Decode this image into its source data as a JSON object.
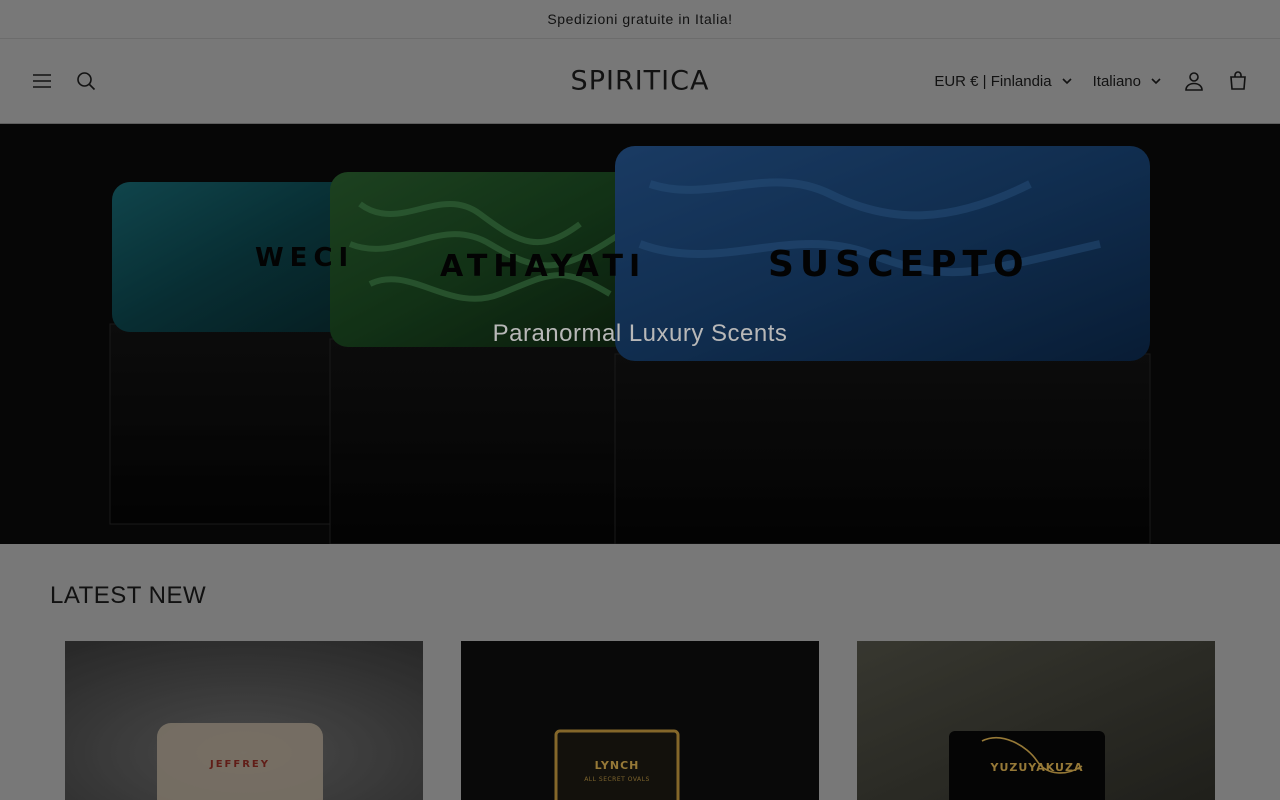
{
  "announcement": "Spedizioni gratuite in Italia!",
  "header": {
    "logo": "SPIRITICA",
    "currency": "EUR € | Finlandia",
    "language": "Italiano",
    "icons": [
      "menu-icon",
      "search-icon",
      "account-icon",
      "cart-icon"
    ]
  },
  "hero": {
    "title": "Paranormal Luxury Scents",
    "bottle_labels": [
      "WECI",
      "ATHAYATI",
      "SUSCEPTO"
    ]
  },
  "latest": {
    "heading": "LATEST NEW",
    "products": [
      {
        "label": "JEFFREY"
      },
      {
        "label": "LYNCH",
        "sub": "ALL SECRET OVALS"
      },
      {
        "label": "YUZUYAKUZA"
      }
    ]
  }
}
